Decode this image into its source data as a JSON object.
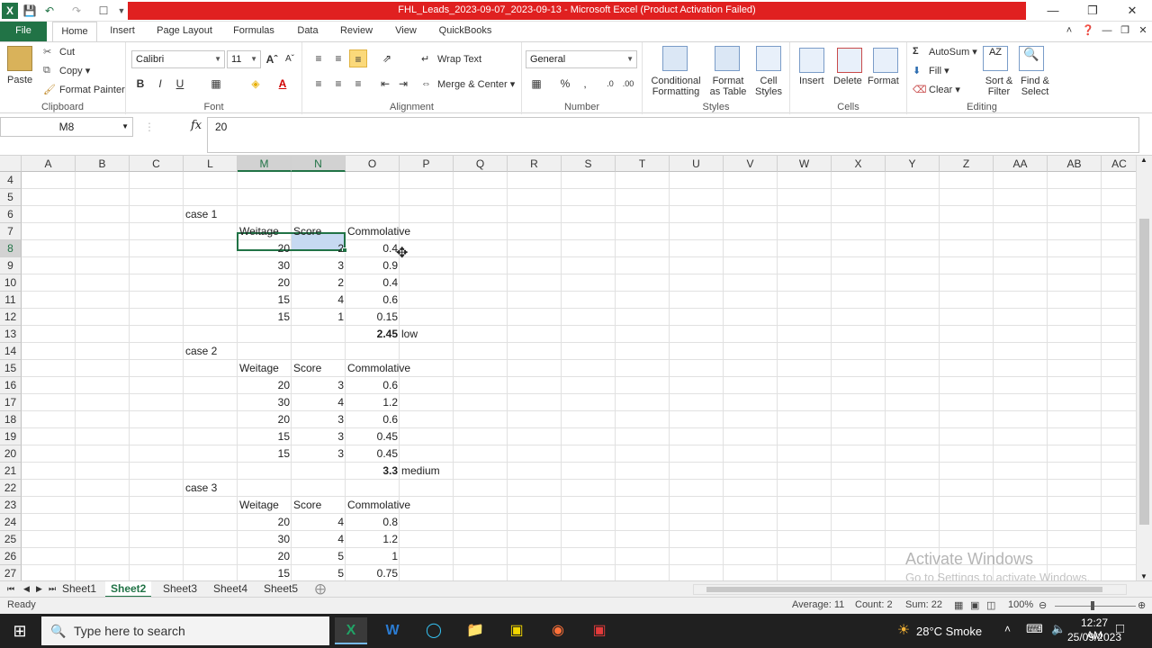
{
  "window": {
    "title": "FHL_Leads_2023-09-07_2023-09-13  -  Microsoft Excel (Product Activation Failed)"
  },
  "ribbon": {
    "tabs": [
      "File",
      "Home",
      "Insert",
      "Page Layout",
      "Formulas",
      "Data",
      "Review",
      "View",
      "QuickBooks"
    ],
    "active_tab": "Home",
    "clipboard": {
      "paste": "Paste",
      "cut": "Cut",
      "copy": "Copy",
      "format_painter": "Format Painter",
      "label": "Clipboard"
    },
    "font": {
      "name": "Calibri",
      "size": "11",
      "label": "Font"
    },
    "alignment": {
      "wrap_text": "Wrap Text",
      "merge_center": "Merge & Center",
      "label": "Alignment"
    },
    "number": {
      "format": "General",
      "label": "Number"
    },
    "styles": {
      "conditional": "Conditional",
      "conditional2": "Formatting",
      "format_as": "Format",
      "format_as2": "as Table",
      "cell": "Cell",
      "cell2": "Styles",
      "label": "Styles"
    },
    "cells": {
      "insert": "Insert",
      "delete": "Delete",
      "format": "Format",
      "label": "Cells"
    },
    "editing": {
      "autosum": "AutoSum",
      "fill": "Fill",
      "clear": "Clear",
      "sort": "Sort &",
      "sort2": "Filter",
      "find": "Find &",
      "find2": "Select",
      "label": "Editing"
    }
  },
  "formula_bar": {
    "name_box": "M8",
    "fx": "fx",
    "value": "20"
  },
  "grid": {
    "columns": [
      "A",
      "B",
      "C",
      "L",
      "M",
      "N",
      "O",
      "P",
      "Q",
      "R",
      "S",
      "T",
      "U",
      "V",
      "W",
      "X",
      "Y",
      "Z",
      "AA",
      "AB",
      "AC"
    ],
    "rows": [
      "4",
      "5",
      "6",
      "7",
      "8",
      "9",
      "10",
      "11",
      "12",
      "13",
      "14",
      "15",
      "16",
      "17",
      "18",
      "19",
      "20",
      "21",
      "22",
      "23",
      "24",
      "25",
      "26",
      "27"
    ],
    "cells": {
      "case1": "case 1",
      "case2": "case 2",
      "case3": "case 3",
      "h_weitage": "Weitage",
      "h_score": "Score",
      "h_comm": "Commolative",
      "r8m": "20",
      "r8n": "2",
      "r8o": "0.4",
      "r9m": "30",
      "r9n": "3",
      "r9o": "0.9",
      "r10m": "20",
      "r10n": "2",
      "r10o": "0.4",
      "r11m": "15",
      "r11n": "4",
      "r11o": "0.6",
      "r12m": "15",
      "r12n": "1",
      "r12o": "0.15",
      "r13o": "2.45",
      "r13p": "low",
      "r16m": "20",
      "r16n": "3",
      "r16o": "0.6",
      "r17m": "30",
      "r17n": "4",
      "r17o": "1.2",
      "r18m": "20",
      "r18n": "3",
      "r18o": "0.6",
      "r19m": "15",
      "r19n": "3",
      "r19o": "0.45",
      "r20m": "15",
      "r20n": "3",
      "r20o": "0.45",
      "r21o": "3.3",
      "r21p": "medium",
      "r24m": "20",
      "r24n": "4",
      "r24o": "0.8",
      "r25m": "30",
      "r25n": "4",
      "r25o": "1.2",
      "r26m": "20",
      "r26n": "5",
      "r26o": "1",
      "r27m": "15",
      "r27n": "5",
      "r27o": "0.75"
    }
  },
  "sheets": [
    "Sheet1",
    "Sheet2",
    "Sheet3",
    "Sheet4",
    "Sheet5"
  ],
  "active_sheet": "Sheet2",
  "status": {
    "ready": "Ready",
    "average": "Average: 11",
    "count": "Count: 2",
    "sum": "Sum: 22",
    "zoom": "100%"
  },
  "watermark": {
    "line1": "Activate Windows",
    "line2": "Go to Settings to activate Windows."
  },
  "taskbar": {
    "search_placeholder": "Type here to search",
    "weather": "28°C  Smoke",
    "time": "12:27 AM",
    "date": "25/09/2023"
  },
  "colors": {
    "excel_green": "#217346",
    "title_red": "#e02020",
    "selection_blue": "#c6d9f1"
  }
}
